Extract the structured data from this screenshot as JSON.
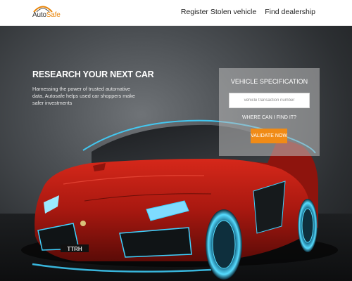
{
  "header": {
    "logo": {
      "text_part1": "Auto",
      "text_part2": "Safe"
    },
    "nav": [
      {
        "label": "Register Stolen vehicle"
      },
      {
        "label": "Find dealership"
      }
    ]
  },
  "hero": {
    "title": "RESEARCH YOUR NEXT CAR",
    "description": "Harnessing the power of trusted automative data, Autosafe helps used car shoppers make safer investments",
    "plate": "TTRH"
  },
  "spec_panel": {
    "title": "VEHICLE SPECIFICATION",
    "input_placeholder": "vehicle transaction number",
    "find_link": "WHERE CAN I FIND IT?",
    "validate_button": "VALIDATE NOW"
  },
  "colors": {
    "accent": "#f08b16",
    "car_body": "#b81c12",
    "glow": "#3fd2ff"
  }
}
